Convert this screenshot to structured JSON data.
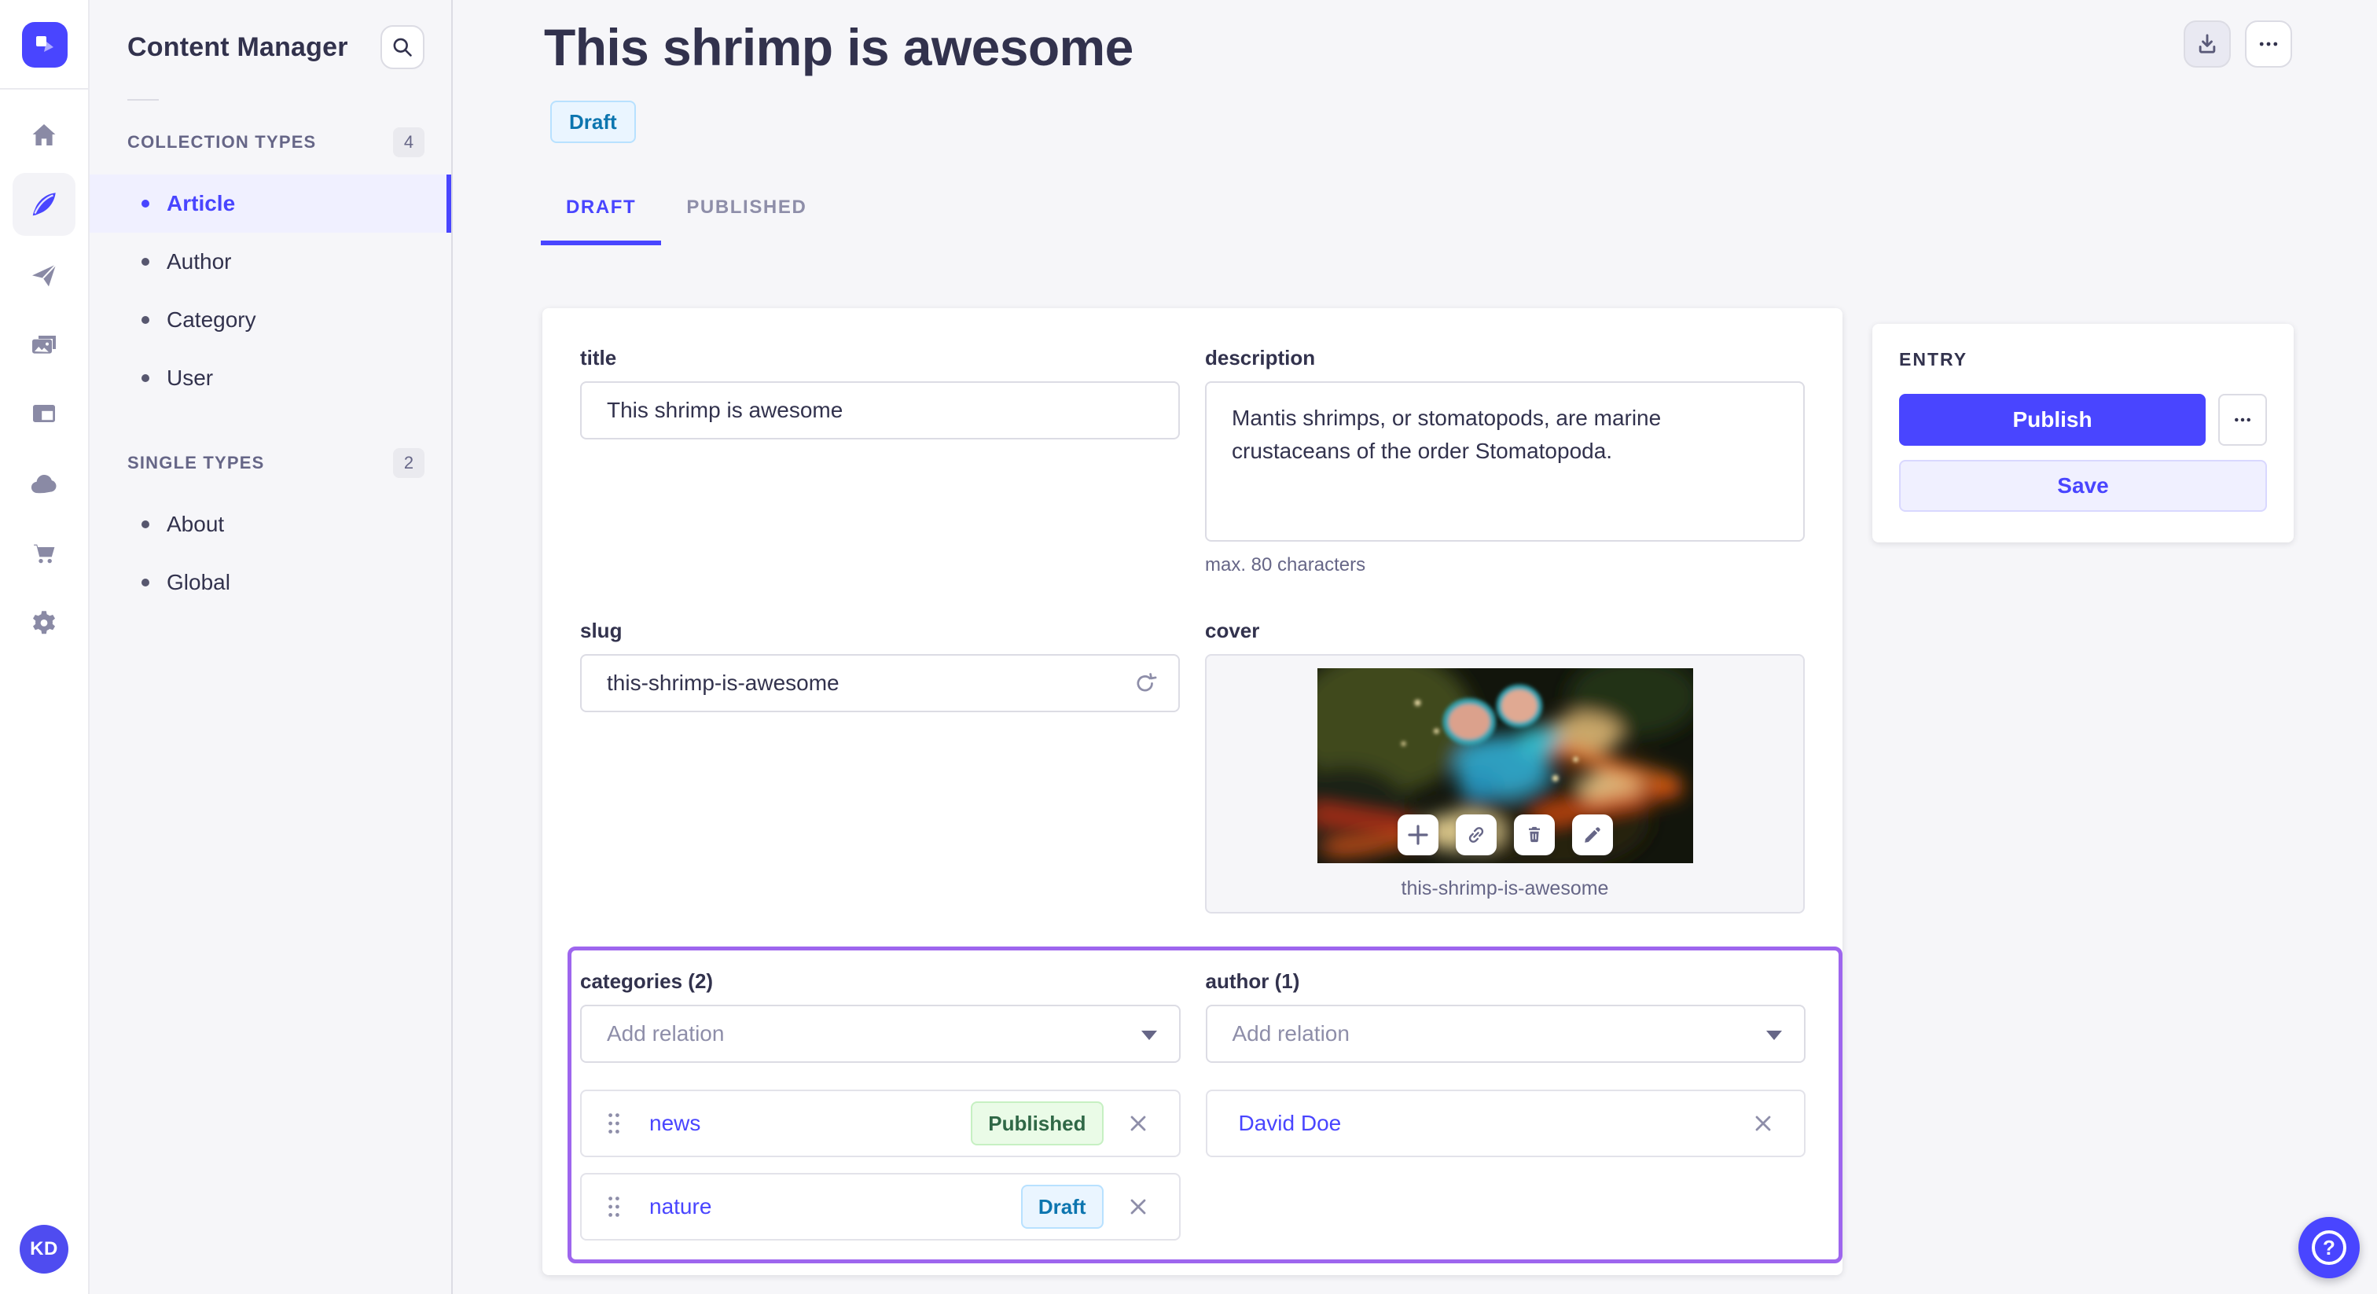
{
  "rail": {
    "logo_icon": "strapi-logo",
    "icons": [
      "home-icon",
      "content-manager-feather-icon",
      "transfer-plane-icon",
      "media-library-icon",
      "content-type-builder-icon",
      "cloud-icon",
      "marketplace-cart-icon",
      "settings-gear-icon"
    ],
    "avatar_initials": "KD"
  },
  "sidebar": {
    "title": "Content Manager",
    "search_icon": "search-icon",
    "collection_types": {
      "label": "COLLECTION TYPES",
      "count": "4",
      "items": [
        {
          "label": "Article"
        },
        {
          "label": "Author"
        },
        {
          "label": "Category"
        },
        {
          "label": "User"
        }
      ]
    },
    "single_types": {
      "label": "SINGLE TYPES",
      "count": "2",
      "items": [
        {
          "label": "About"
        },
        {
          "label": "Global"
        }
      ]
    }
  },
  "header": {
    "title": "This shrimp is awesome",
    "status": "Draft",
    "tabs": [
      {
        "label": "DRAFT"
      },
      {
        "label": "PUBLISHED"
      }
    ]
  },
  "form": {
    "title": {
      "label": "title",
      "value": "This shrimp is awesome"
    },
    "description": {
      "label": "description",
      "value": "Mantis shrimps, or stomatopods, are marine crustaceans of the order Stomatopoda.",
      "hint": "max. 80 characters"
    },
    "slug": {
      "label": "slug",
      "value": "this-shrimp-is-awesome"
    },
    "cover": {
      "label": "cover",
      "caption": "this-shrimp-is-awesome"
    },
    "categories": {
      "label": "categories (2)",
      "placeholder": "Add relation",
      "items": [
        {
          "name": "news",
          "status": "Published"
        },
        {
          "name": "nature",
          "status": "Draft"
        }
      ]
    },
    "author": {
      "label": "author (1)",
      "placeholder": "Add relation",
      "items": [
        {
          "name": "David Doe"
        }
      ]
    }
  },
  "entry_panel": {
    "title": "ENTRY",
    "publish_label": "Publish",
    "save_label": "Save"
  },
  "colors": {
    "accent_indigo": "#4945ff",
    "highlight_purple": "#9e66ee",
    "draft_badge_bg": "#eaf5ff",
    "draft_badge_text": "#0c75af",
    "published_badge_bg": "#eafbe7",
    "published_badge_text": "#2f6846"
  }
}
